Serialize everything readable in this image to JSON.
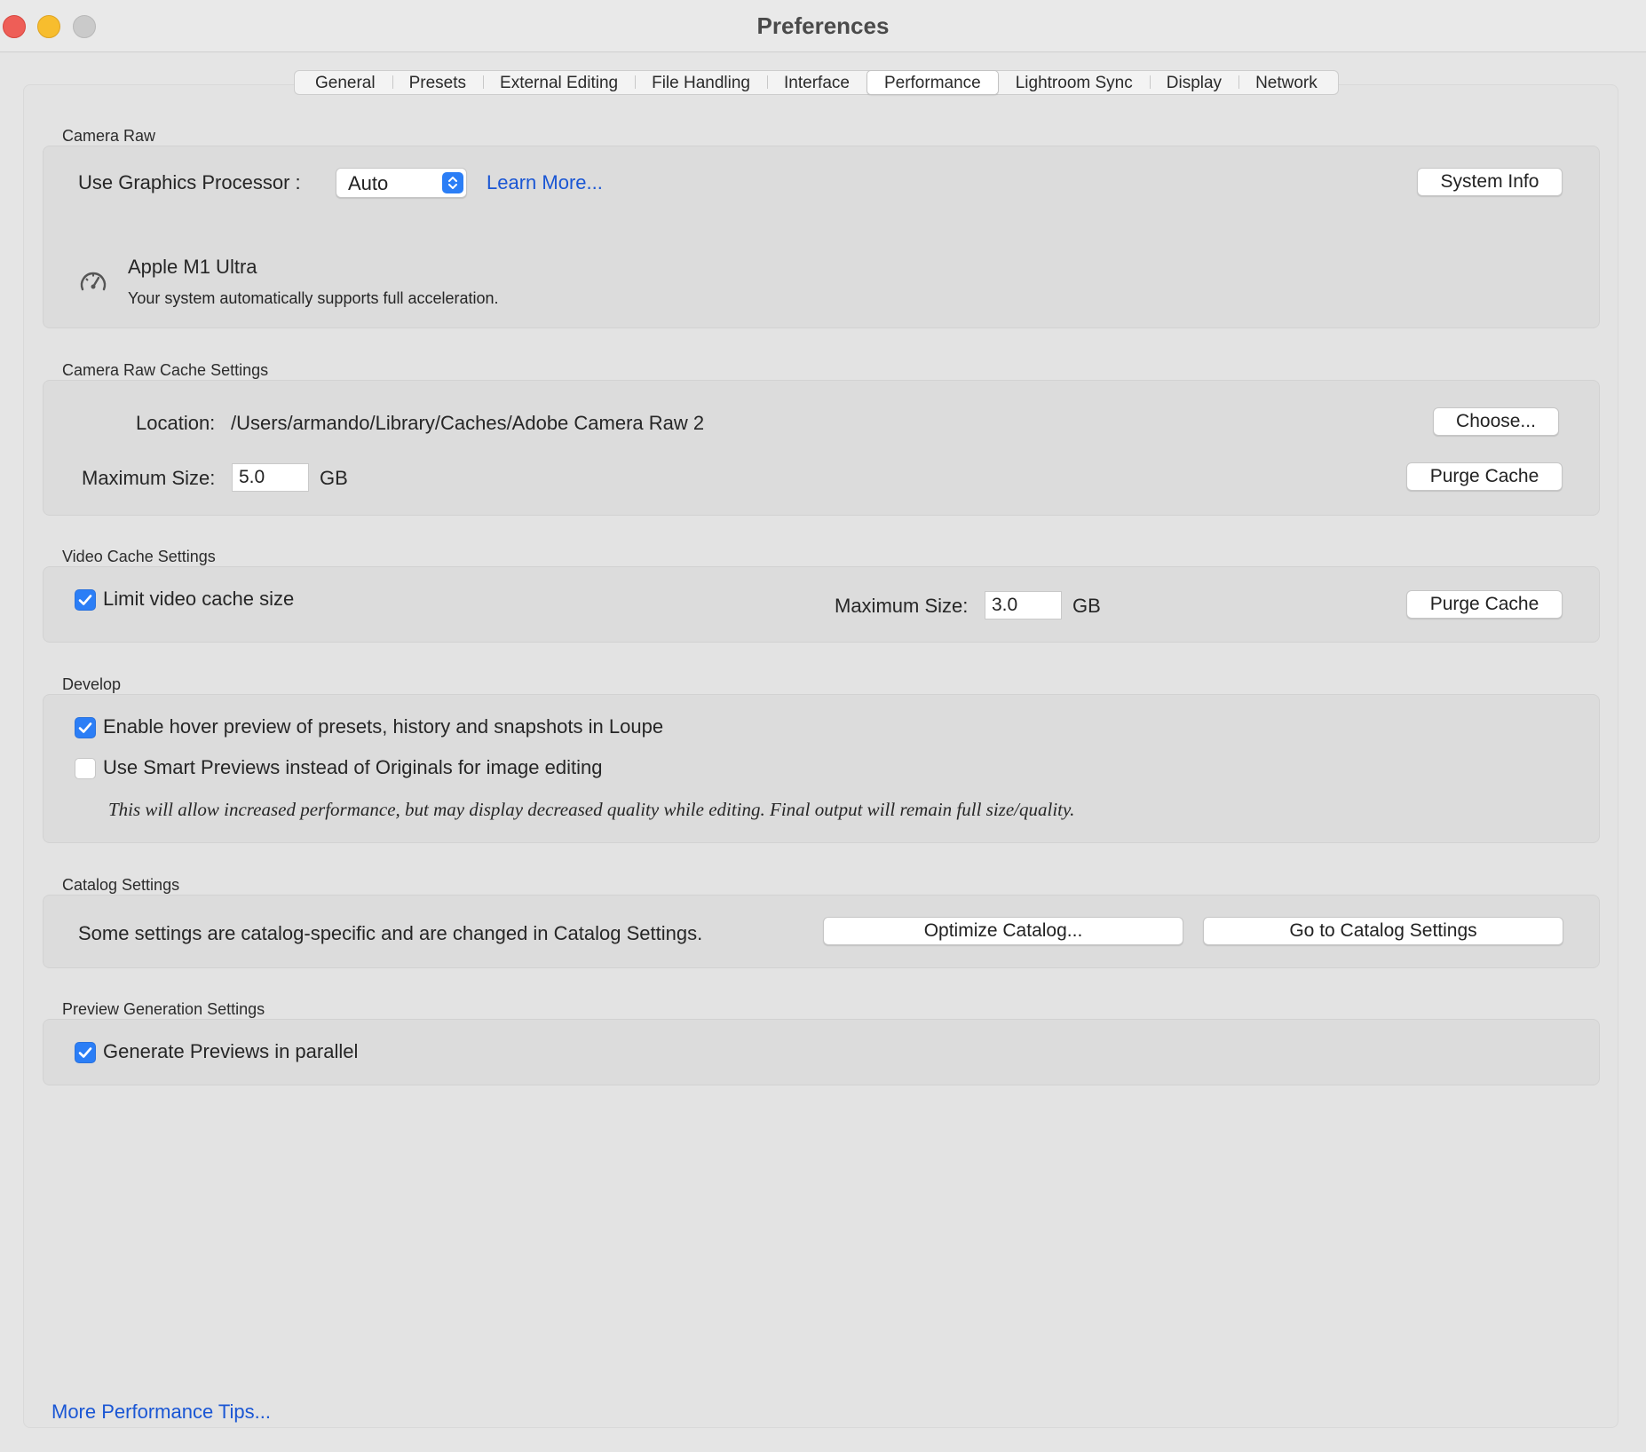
{
  "window": {
    "title": "Preferences"
  },
  "tabs": [
    {
      "label": "General"
    },
    {
      "label": "Presets"
    },
    {
      "label": "External Editing"
    },
    {
      "label": "File Handling"
    },
    {
      "label": "Interface"
    },
    {
      "label": "Performance",
      "active": true
    },
    {
      "label": "Lightroom Sync"
    },
    {
      "label": "Display"
    },
    {
      "label": "Network"
    }
  ],
  "camera_raw": {
    "title": "Camera Raw",
    "gpu_label": "Use Graphics Processor :",
    "gpu_value": "Auto",
    "learn_more": "Learn More...",
    "system_info": "System Info",
    "gpu_name": "Apple M1 Ultra",
    "gpu_status": "Your system automatically supports full acceleration."
  },
  "cache": {
    "title": "Camera Raw Cache Settings",
    "location_label": "Location:",
    "location_value": "/Users/armando/Library/Caches/Adobe Camera Raw 2",
    "choose": "Choose...",
    "max_label": "Maximum Size:",
    "max_value": "5.0",
    "unit": "GB",
    "purge": "Purge Cache"
  },
  "video_cache": {
    "title": "Video Cache Settings",
    "limit_label": "Limit video cache size",
    "limit_checked": true,
    "max_label": "Maximum Size:",
    "max_value": "3.0",
    "unit": "GB",
    "purge": "Purge Cache"
  },
  "develop": {
    "title": "Develop",
    "hover_label": "Enable hover preview of presets, history and snapshots in Loupe",
    "hover_checked": true,
    "smart_label": "Use Smart Previews instead of Originals for image editing",
    "smart_checked": false,
    "note": "This will allow increased performance, but may display decreased quality while editing. Final output will remain full size/quality."
  },
  "catalog": {
    "title": "Catalog Settings",
    "desc": "Some settings are catalog-specific and are changed in Catalog Settings.",
    "optimize": "Optimize Catalog...",
    "goto": "Go to Catalog Settings"
  },
  "preview": {
    "title": "Preview Generation Settings",
    "parallel_label": "Generate Previews in parallel",
    "parallel_checked": true
  },
  "footer": {
    "tips": "More Performance Tips..."
  },
  "colors": {
    "accent": "#2b7ef6",
    "link": "#1a56d4",
    "close": "#ee5e57",
    "minimize": "#f7bd2e",
    "zoom": "#cacaca"
  },
  "icons": {
    "gauge": "speedometer-icon",
    "check": "checkmark-icon",
    "stepper": "chevron-up-down-icon"
  }
}
